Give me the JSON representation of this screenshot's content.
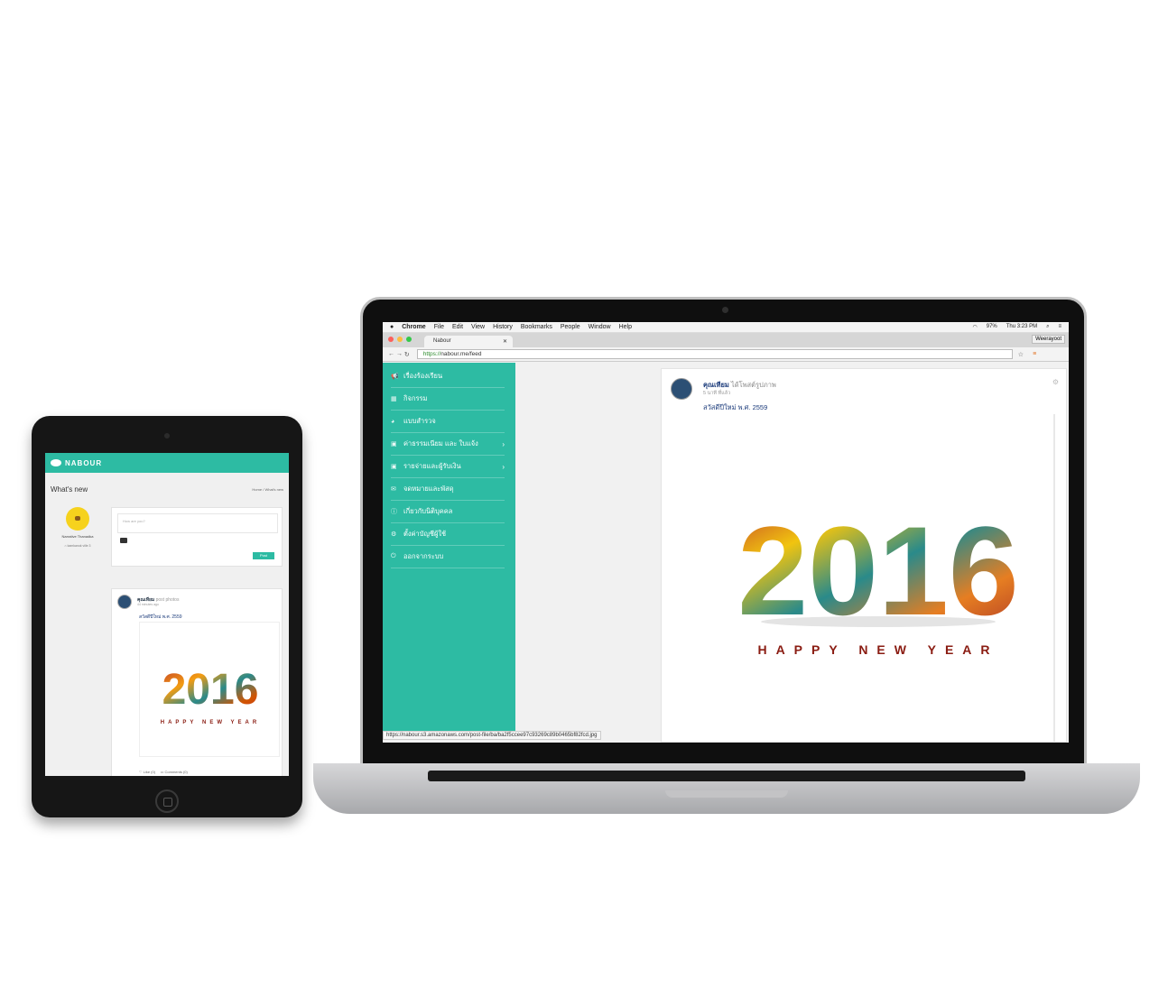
{
  "tablet": {
    "brand": "NABOUR",
    "page_title": "What's new",
    "breadcrumb": {
      "home": "Home",
      "sep": "/",
      "current": "What's new"
    },
    "profile": {
      "name": "Narrative Thanadka",
      "location": "kamkanok ville 3"
    },
    "composer": {
      "placeholder": "How are you?",
      "post_label": "Post"
    },
    "post": {
      "author": "คุณเทียม",
      "action": "post photos",
      "time": "44 minutes ago",
      "text": "สวัสดีปีใหม่ พ.ศ. 2559",
      "like_label": "Like (0)",
      "comments_label": "Comments (0)"
    }
  },
  "laptop": {
    "menubar": {
      "items": [
        "Chrome",
        "File",
        "Edit",
        "View",
        "History",
        "Bookmarks",
        "People",
        "Window",
        "Help"
      ],
      "battery": "97%",
      "clock": "Thu 3:23 PM"
    },
    "browser": {
      "tab_title": "Nabour",
      "profile": "Weerayoot",
      "url_scheme": "https://",
      "url_rest": "nabour.me/feed",
      "status_url": "https://nabour.s3.amazonaws.com/post-file/ba/ba2f5ccee97c93269c89b0465bf82fcd.jpg"
    },
    "sidebar": [
      {
        "label": "เรื่องร้องเรียน",
        "icon": "megaphone-icon",
        "glyph": "📢",
        "chevron": false
      },
      {
        "label": "กิจกรรม",
        "icon": "calendar-icon",
        "glyph": "▦",
        "chevron": false
      },
      {
        "label": "แบบสำรวจ",
        "icon": "pie-chart-icon",
        "glyph": "◕",
        "chevron": false
      },
      {
        "label": "ค่าธรรมเนียม และ ใบแจ้ง",
        "icon": "money-icon",
        "glyph": "▣",
        "chevron": true
      },
      {
        "label": "รายจ่ายและผู้รับเงิน",
        "icon": "money-icon",
        "glyph": "▣",
        "chevron": true
      },
      {
        "label": "จดหมายและพัสดุ",
        "icon": "envelope-icon",
        "glyph": "✉",
        "chevron": false
      },
      {
        "label": "เกี่ยวกับนิติบุคคล",
        "icon": "info-icon",
        "glyph": "ⓘ",
        "chevron": false
      },
      {
        "label": "ตั้งค่าบัญชีผู้ใช้",
        "icon": "gears-icon",
        "glyph": "⚙",
        "chevron": false
      },
      {
        "label": "ออกจากระบบ",
        "icon": "power-icon",
        "glyph": "⏻",
        "chevron": false
      }
    ],
    "post": {
      "author": "คุณเทียม",
      "action": "ได้โพสต์รูปภาพ",
      "time": "5 นาที ที่แล้ว",
      "text": "สวัสดีปีใหม่ พ.ศ. 2559"
    }
  },
  "artwork": {
    "year": "2016",
    "tagline": "HAPPY NEW YEAR",
    "tagline_color": "#8a1c12"
  },
  "colors": {
    "accent": "#2dbba3"
  }
}
